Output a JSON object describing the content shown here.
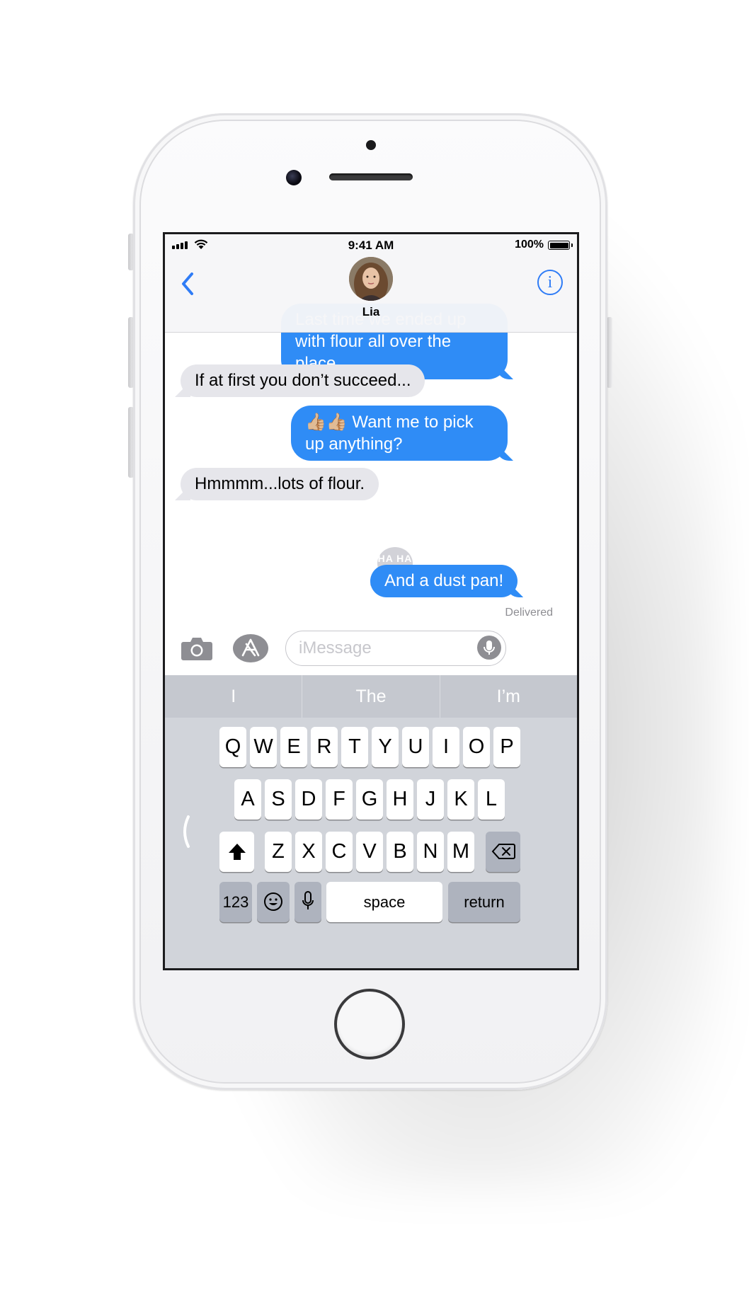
{
  "status_bar": {
    "time": "9:41 AM",
    "battery": "100%"
  },
  "header": {
    "contact_name": "Lia",
    "info_glyph": "i"
  },
  "messages": [
    {
      "from": "me",
      "text": "Last time we ended up with flour all over the place."
    },
    {
      "from": "them",
      "text": "If at first you don’t succeed..."
    },
    {
      "from": "me",
      "text": "👍🏼👍🏼 Want me to pick up anything?"
    },
    {
      "from": "them",
      "text": "Hmmmm...lots of flour."
    },
    {
      "from": "me",
      "text": "And a dust pan!",
      "tapback": "HA HA"
    }
  ],
  "delivery_status": "Delivered",
  "compose": {
    "placeholder": "iMessage",
    "value": ""
  },
  "keyboard": {
    "predictions": [
      "I",
      "The",
      "I’m"
    ],
    "row1": [
      "Q",
      "W",
      "E",
      "R",
      "T",
      "Y",
      "U",
      "I",
      "O",
      "P"
    ],
    "row2": [
      "A",
      "S",
      "D",
      "F",
      "G",
      "H",
      "J",
      "K",
      "L"
    ],
    "row3": [
      "Z",
      "X",
      "C",
      "V",
      "B",
      "N",
      "M"
    ],
    "numbers_key": "123",
    "space_key": "space",
    "return_key": "return"
  },
  "icons": [
    "back-chevron-icon",
    "info-icon",
    "camera-icon",
    "app-store-icon",
    "microphone-icon",
    "shift-icon",
    "delete-icon",
    "emoji-icon",
    "keyboard-mic-icon",
    "wifi-icon",
    "signal-icon",
    "battery-icon"
  ],
  "colors": {
    "sent_bubble": "#2f8cf6",
    "received_bubble": "#e6e6eb",
    "accent": "#2f7cf6",
    "keyboard_bg": "#d1d4da"
  }
}
